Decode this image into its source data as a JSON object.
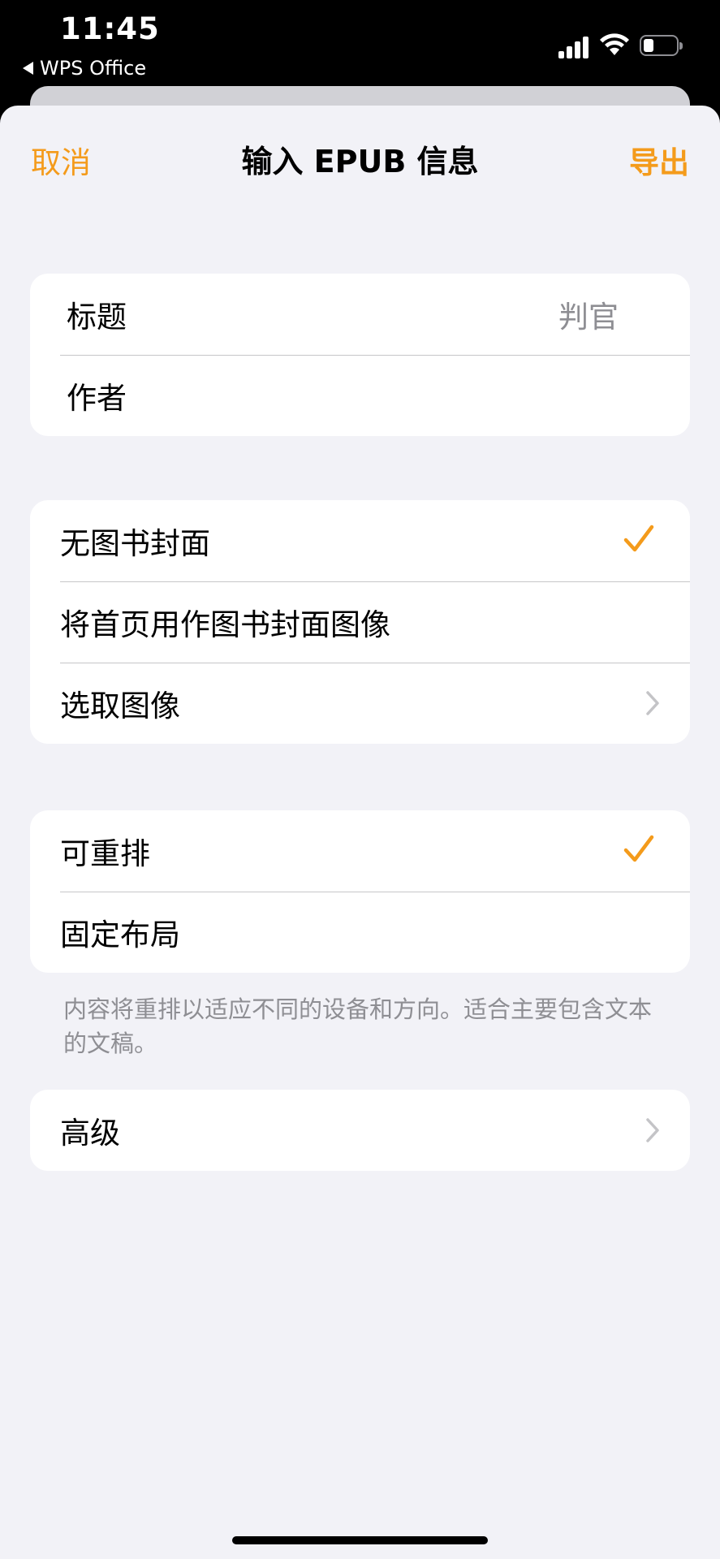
{
  "status_bar": {
    "time": "11:45",
    "back_app": "WPS Office"
  },
  "nav": {
    "cancel": "取消",
    "title": "输入 EPUB 信息",
    "export": "导出"
  },
  "metadata": {
    "title_label": "标题",
    "title_value": "判官",
    "author_label": "作者"
  },
  "cover": {
    "options": [
      "无图书封面",
      "将首页用作图书封面图像",
      "选取图像"
    ],
    "selected": "无图书封面"
  },
  "layout": {
    "options": [
      "可重排",
      "固定布局"
    ],
    "selected": "可重排",
    "note": "内容将重排以适应不同的设备和方向。适合主要包含文本的文稿。"
  },
  "advanced": {
    "label": "高级"
  },
  "colors": {
    "accent": "#f49b1b",
    "background": "#f2f2f7",
    "secondary_text": "#8e8e93"
  }
}
